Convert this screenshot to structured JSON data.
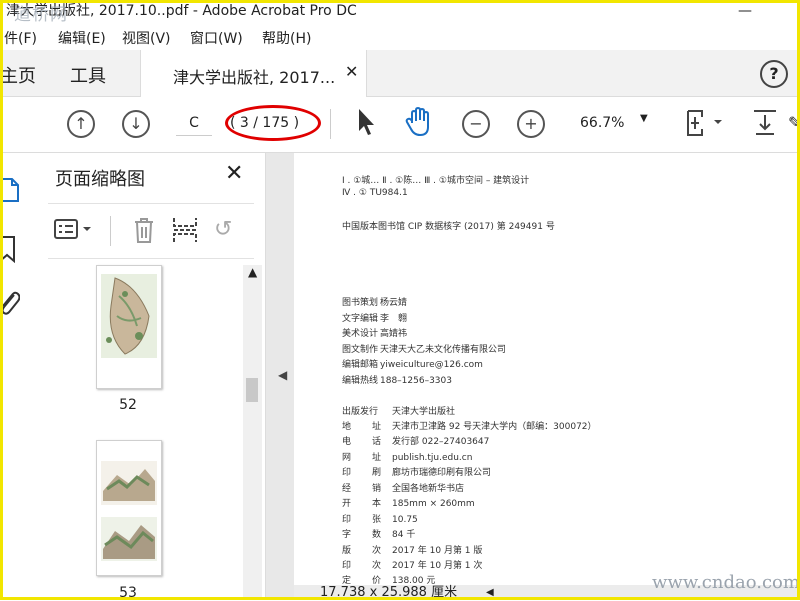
{
  "window": {
    "title": "津大学出版社, 2017.10..pdf - Adobe Acrobat Pro DC",
    "watermark_top": "道桥网",
    "minimize": "—"
  },
  "menu": [
    "件(F)",
    "编辑(E)",
    "视图(V)",
    "窗口(W)",
    "帮助(H)"
  ],
  "tabs": {
    "home": "主页",
    "tools": "工具",
    "document": "津大学出版社, 2017...",
    "close": "✕",
    "help": "?"
  },
  "toolbar": {
    "page_current": "C",
    "page_count": "( 3 / 175 )",
    "zoom": "66.7%"
  },
  "panel": {
    "title": "页面缩略图",
    "close": "✕",
    "thumbnails": [
      {
        "label": "52"
      },
      {
        "label": "53"
      }
    ]
  },
  "document": {
    "cip_lines": [
      "Ⅰ . ①城… Ⅱ . ①陈… Ⅲ . ①城市空间 – 建筑设计",
      "Ⅳ . ① TU984.1",
      "中国版本图书馆 CIP 数据核字 (2017) 第 249491 号"
    ],
    "credits": [
      {
        "k": "图书策划",
        "v": "杨云婧"
      },
      {
        "k": "文字编辑",
        "v": "李　翱"
      },
      {
        "k": "美术设计",
        "v": "高婧祎"
      },
      {
        "k": "图文制作",
        "v": "天津天大乙未文化传播有限公司"
      },
      {
        "k": "编辑邮箱",
        "v": "yiweiculture@126.com"
      },
      {
        "k": "编辑热线",
        "v": "188–1256–3303"
      }
    ],
    "publish": [
      {
        "k": "出版发行",
        "v": "天津大学出版社"
      },
      {
        "k": "地　址",
        "v": "天津市卫津路 92 号天津大学内（邮编：300072）"
      },
      {
        "k": "电　话",
        "v": "发行部 022–27403647"
      },
      {
        "k": "网　址",
        "v": "publish.tju.edu.cn"
      },
      {
        "k": "印　刷",
        "v": "廊坊市瑞德印刷有限公司"
      },
      {
        "k": "经　销",
        "v": "全国各地新华书店"
      },
      {
        "k": "开　本",
        "v": "185mm × 260mm"
      },
      {
        "k": "印　张",
        "v": "10.75"
      },
      {
        "k": "字　数",
        "v": "84 千"
      },
      {
        "k": "版　次",
        "v": "2017 年 10 月第 1 版"
      },
      {
        "k": "印　次",
        "v": "2017 年 10 月第 1 次"
      },
      {
        "k": "定　价",
        "v": "138.00 元"
      }
    ]
  },
  "status": {
    "page_size": "17.738 x 25.988 厘米"
  },
  "watermark_bottom": "www.cndao.com"
}
